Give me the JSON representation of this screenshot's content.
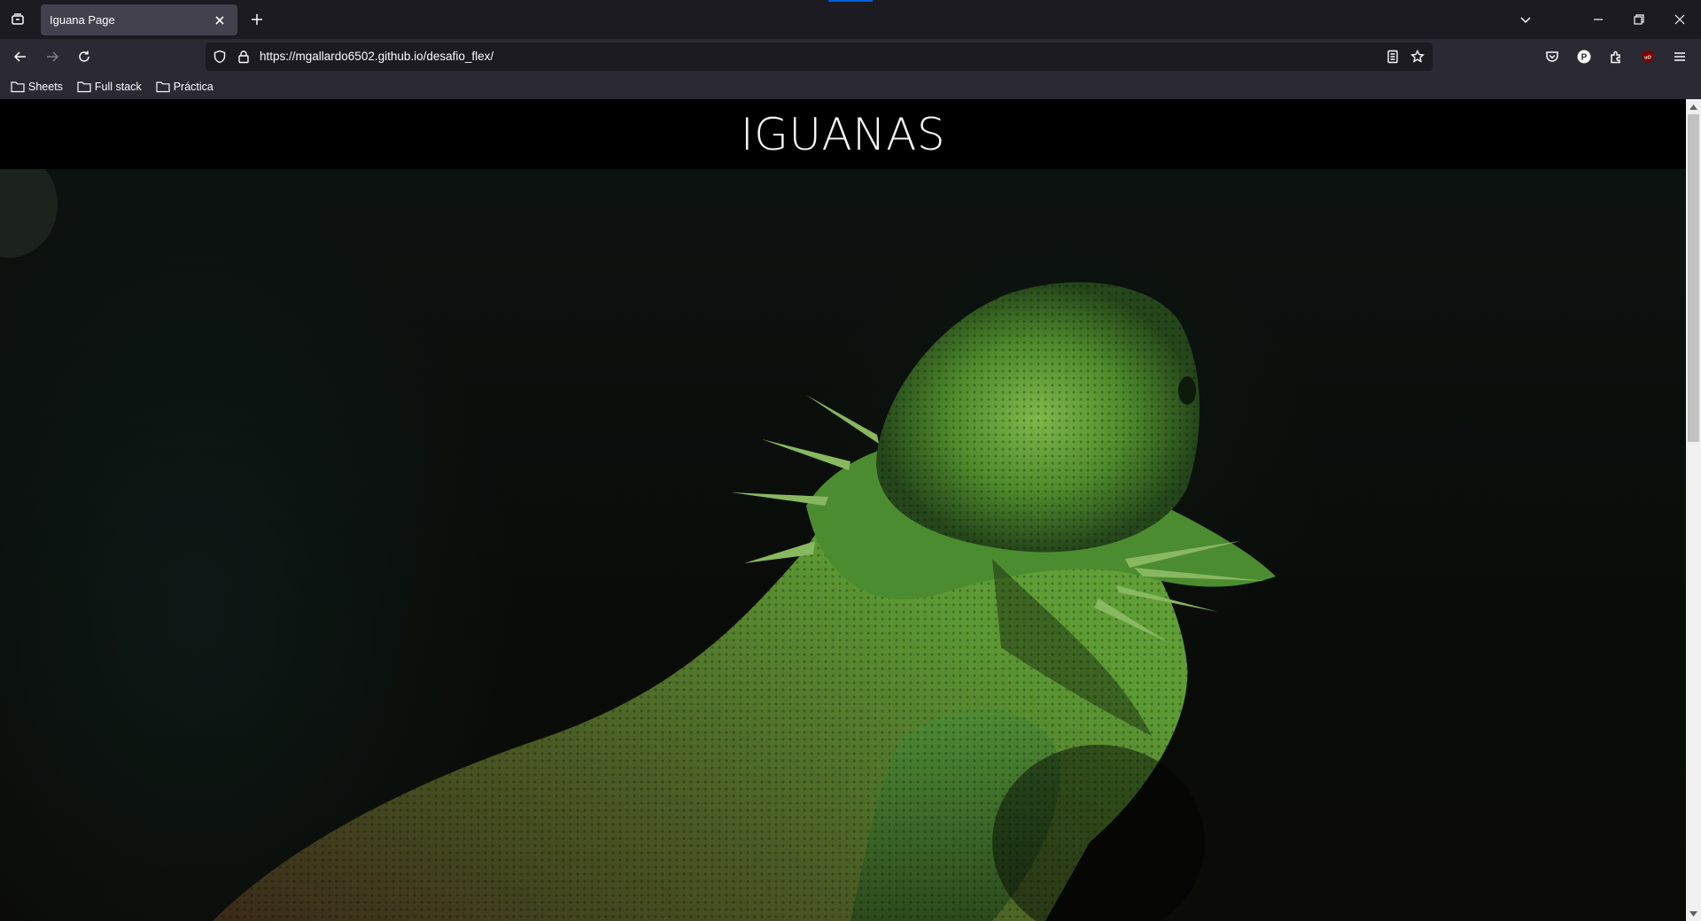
{
  "browser": {
    "tab": {
      "title": "Iguana Page"
    },
    "url": "https://mgallardo6502.github.io/desafio_flex/",
    "bookmarks": [
      {
        "label": "Sheets"
      },
      {
        "label": "Full stack"
      },
      {
        "label": "Práctica"
      }
    ],
    "toolbar_icons": [
      "list-all-tabs-icon",
      "new-tab-icon",
      "tab-overflow-icon",
      "minimize-icon",
      "restore-icon",
      "close-window-icon",
      "back-icon",
      "forward-icon",
      "reload-icon",
      "tracking-shield-icon",
      "lock-icon",
      "reader-view-icon",
      "bookmark-star-icon",
      "pocket-icon",
      "account-icon",
      "extensions-icon",
      "ublock-icon",
      "app-menu-icon"
    ]
  },
  "page": {
    "title": "IGUANAS",
    "hero_image": {
      "subject": "green-lizard",
      "accent_color": "#4f8a2c"
    }
  },
  "colors": {
    "tabstrip": "#1c1b22",
    "navbar": "#2b2a33",
    "active_tab": "#42414d",
    "page_header": "#000000"
  }
}
